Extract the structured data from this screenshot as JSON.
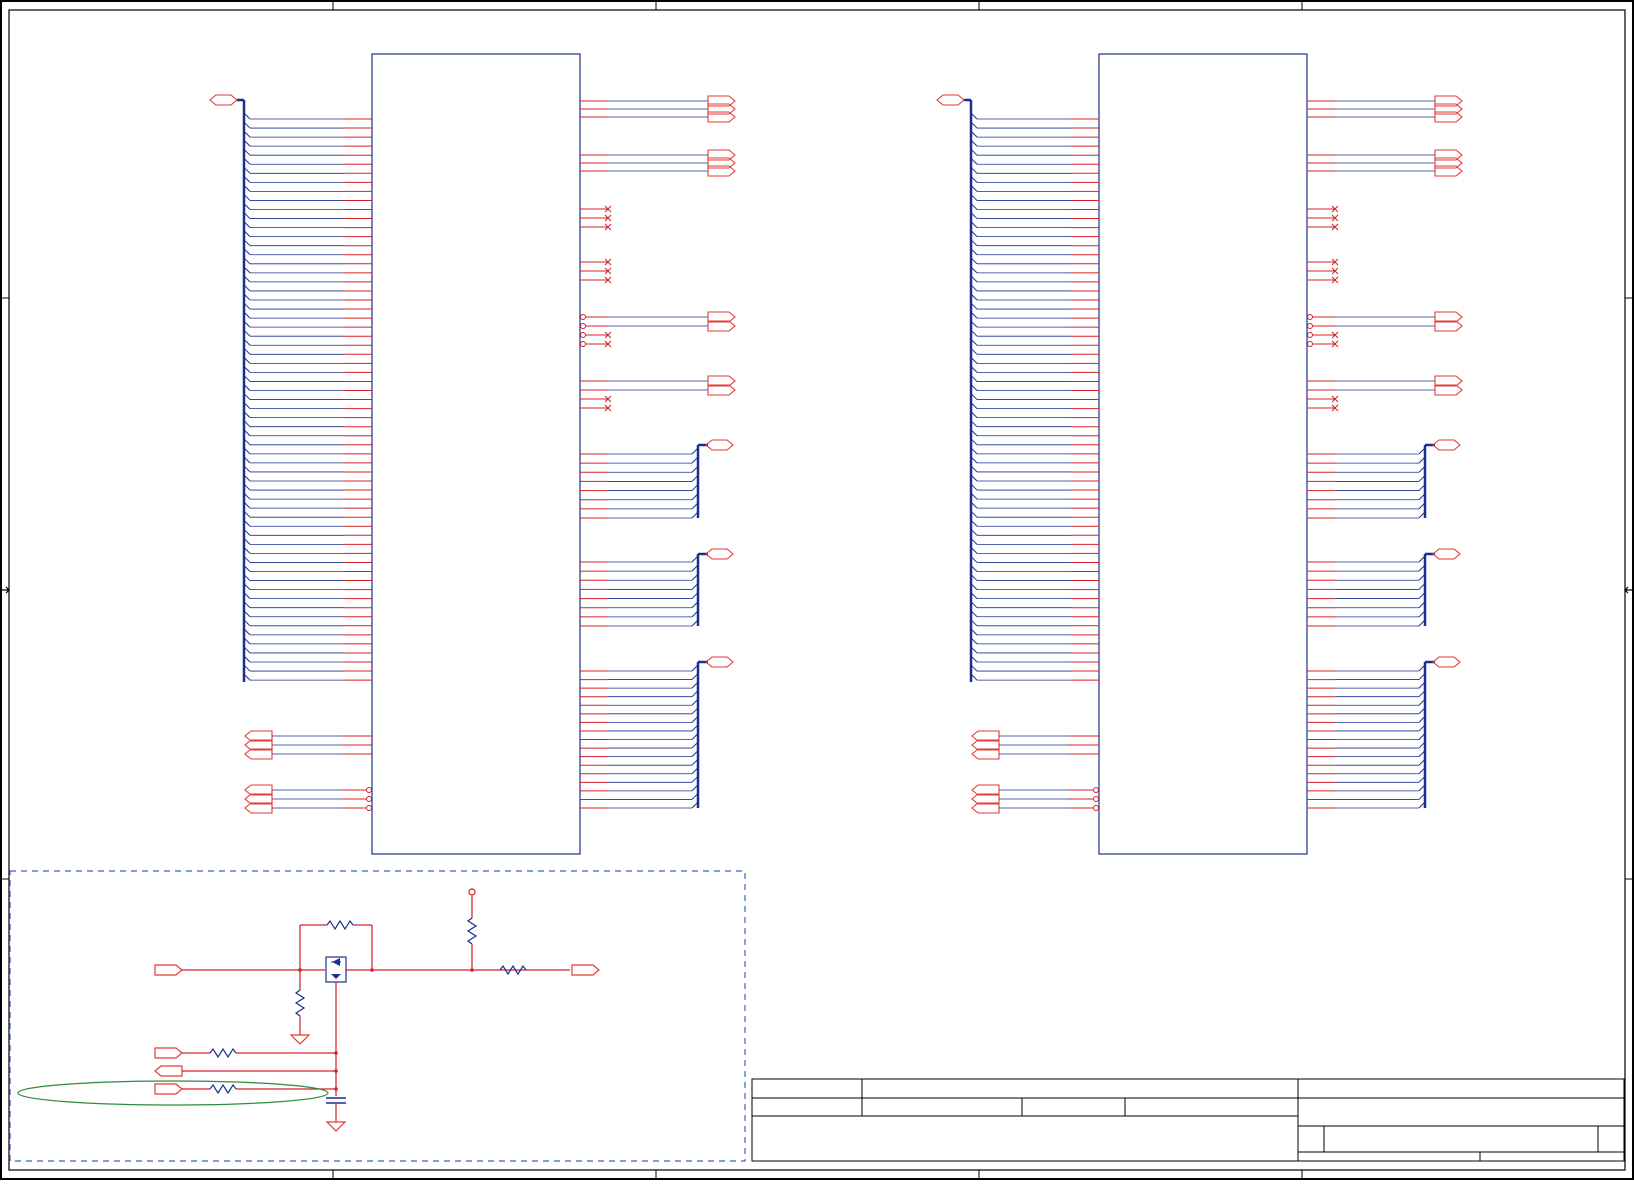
{
  "sheet": {
    "title_block": {
      "title": "",
      "document_number": "",
      "revision": "",
      "sheet": "",
      "date": ""
    }
  },
  "colors": {
    "wire": "#d32027",
    "bus": "#1a2f8f",
    "component": "#1a2f8f",
    "port": "#e53935",
    "border": "#000000",
    "region": "#3b62c4",
    "highlight": "#2e8b3e"
  },
  "modules": [
    {
      "id": "left-memory-block"
    },
    {
      "id": "right-memory-block"
    }
  ],
  "icons": [
    "connector-port-icon",
    "no-connect-icon",
    "resistor-icon",
    "capacitor-icon",
    "ground-icon",
    "diode-icon",
    "power-pin-icon"
  ]
}
